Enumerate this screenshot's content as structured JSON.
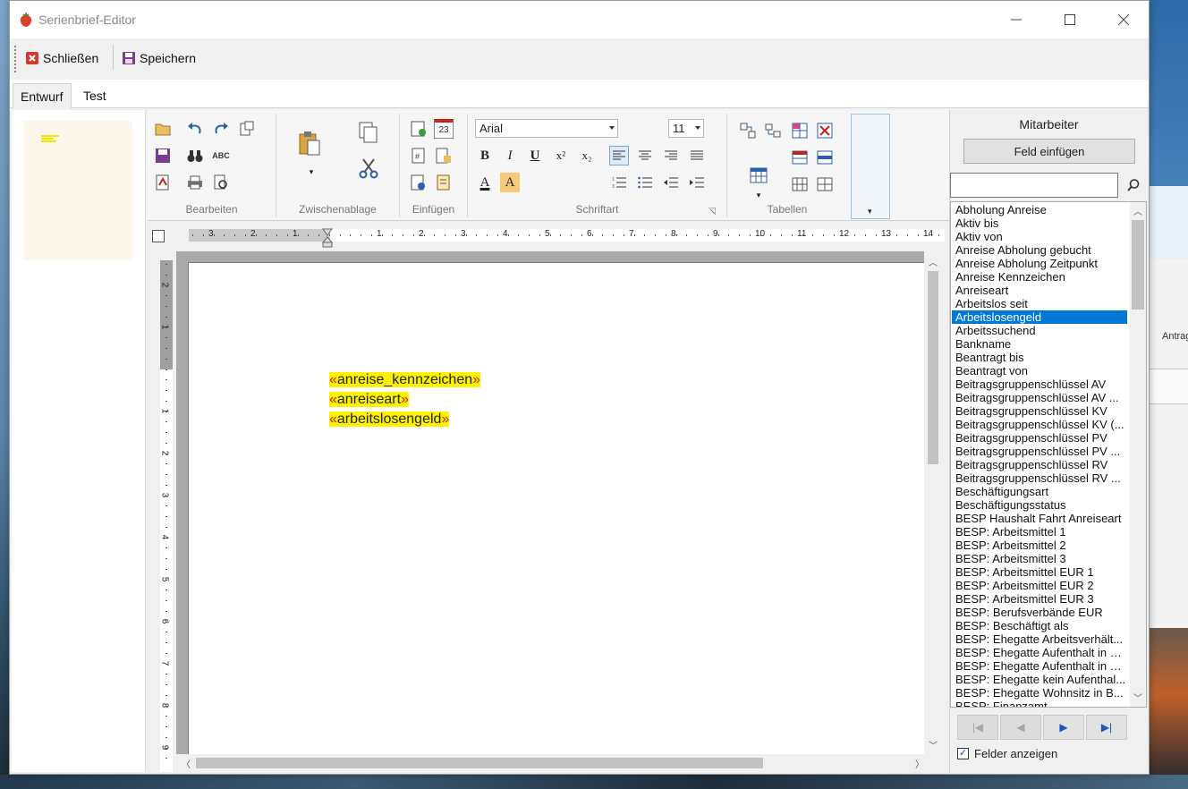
{
  "window": {
    "title": "Serienbrief-Editor"
  },
  "toolbar": {
    "close_label": "Schließen",
    "save_label": "Speichern"
  },
  "tabs": [
    {
      "label": "Entwurf"
    },
    {
      "label": "Test"
    }
  ],
  "ribbon": {
    "groups": {
      "bearbeiten": "Bearbeiten",
      "zwischenablage": "Zwischenablage",
      "einfuegen": "Einfügen",
      "schriftart": "Schriftart",
      "tabellen": "Tabellen"
    },
    "font_name": "Arial",
    "font_size": "11",
    "calendar_text": "23",
    "spell_text": "ABC",
    "format_buttons": {
      "bold": "B",
      "italic": "I",
      "underline": "U",
      "superscript": "x²",
      "subscript": "x₂",
      "font_color": "A",
      "highlight": "A"
    }
  },
  "ruler": {
    "h_numbers": [
      "3",
      "2",
      "1",
      "1",
      "2",
      "3",
      "4",
      "5",
      "6",
      "7",
      "8",
      "9",
      "10",
      "11",
      "12",
      "13",
      "14"
    ],
    "v_numbers": [
      "2",
      "1",
      "1",
      "2",
      "3",
      "4",
      "5",
      "6",
      "7",
      "8",
      "9"
    ]
  },
  "document": {
    "fields": [
      {
        "open": "«",
        "name": "anreise_kennzeichen",
        "close": "»"
      },
      {
        "open": "«",
        "name": "anreiseart",
        "close": "»"
      },
      {
        "open": "«",
        "name": "arbeitslosengeld",
        "close": "»"
      }
    ]
  },
  "side_panel": {
    "title": "Mitarbeiter",
    "insert_button": "Feld einfügen",
    "search_value": "",
    "selected_index": 8,
    "fields": [
      "Abholung Anreise",
      "Aktiv bis",
      "Aktiv von",
      "Anreise Abholung gebucht",
      "Anreise Abholung Zeitpunkt",
      "Anreise Kennzeichen",
      "Anreiseart",
      "Arbeitslos seit",
      "Arbeitslosengeld",
      "Arbeitssuchend",
      "Bankname",
      "Beantragt bis",
      "Beantragt von",
      "Beitragsgruppenschlüssel AV",
      "Beitragsgruppenschlüssel AV ...",
      "Beitragsgruppenschlüssel KV",
      "Beitragsgruppenschlüssel KV (...",
      "Beitragsgruppenschlüssel PV",
      "Beitragsgruppenschlüssel PV ...",
      "Beitragsgruppenschlüssel RV",
      "Beitragsgruppenschlüssel RV ...",
      "Beschäftigungsart",
      "Beschäftigungsstatus",
      "BESP Haushalt Fahrt Anreiseart",
      "BESP: Arbeitsmittel 1",
      "BESP: Arbeitsmittel 2",
      "BESP: Arbeitsmittel 3",
      "BESP: Arbeitsmittel EUR 1",
      "BESP: Arbeitsmittel EUR 2",
      "BESP: Arbeitsmittel EUR 3",
      "BESP: Berufsverbände EUR",
      "BESP: Beschäftigt als",
      "BESP: Ehegatte Arbeitsverhält...",
      "BESP: Ehegatte Aufenthalt in B...",
      "BESP: Ehegatte Aufenthalt in B...",
      "BESP: Ehegatte kein Aufenthal...",
      "BESP: Ehegatte Wohnsitz in B...",
      "BESP: Finanzamt"
    ],
    "nav": {
      "first": "|◀",
      "prev": "◀",
      "next": "▶",
      "last": "▶|"
    },
    "show_fields_label": "Felder anzeigen",
    "show_fields_checked": "✓"
  },
  "background_window": {
    "partial_label": "Antrag"
  },
  "colors": {
    "accent": "#0078d7",
    "field_highlight": "#fff200",
    "field_quote": "#c0261b"
  }
}
